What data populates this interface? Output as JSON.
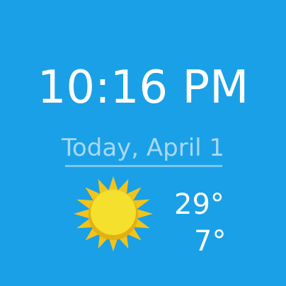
{
  "colors": {
    "background": "#1aa0e6",
    "text": "#ffffff",
    "date_text": "#a9d8f5",
    "underline": "#7cc6f0",
    "sun_rays": "#f2c41a",
    "sun_body": "#f5e12d",
    "sun_rim": "#e2b015"
  },
  "time": "10:16 PM",
  "date": "Today, April 1",
  "weather": {
    "icon": "sun-icon",
    "high": "29°",
    "low": "7°"
  }
}
